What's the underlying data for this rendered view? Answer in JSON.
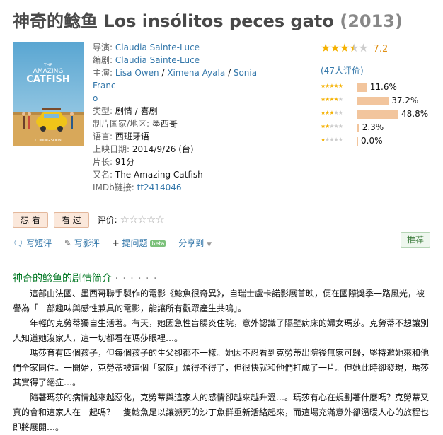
{
  "title": {
    "zh": "神奇的鲶鱼",
    "original": "Los insólitos peces gato",
    "year": "(2013)"
  },
  "poster": {
    "text1": "THE",
    "text2": "AMAZING",
    "text3": "CATFISH",
    "footer": "COMING SOON",
    "colors": {
      "sky": "#6fb5d8",
      "sand": "#d8a85a",
      "car": "#f0c419"
    }
  },
  "info": {
    "director_label": "导演:",
    "director": "Claudia Sainte-Luce",
    "writer_label": "编剧:",
    "writer": "Claudia Sainte-Luce",
    "cast_label": "主演:",
    "cast1": "Lisa Owen",
    "cast_sep1": " / ",
    "cast2": "Ximena Ayala",
    "cast_sep2": " / ",
    "cast3": "Sonia Franc",
    "cast3_cont": "o",
    "genre_label": "类型:",
    "genre1": "剧情",
    "genre_sep": " / ",
    "genre2": "喜剧",
    "country_label": "制片国家/地区:",
    "country": "墨西哥",
    "language_label": "语言:",
    "language": "西班牙语",
    "release_label": "上映日期:",
    "release": "2014/9/26 (台)",
    "runtime_label": "片长:",
    "runtime": "91分",
    "aka_label": "又名:",
    "aka": "The Amazing Catfish",
    "imdb_label": "IMDb链接:",
    "imdb": "tt2414046"
  },
  "rating": {
    "score": "7.2",
    "stars_on": "★★★",
    "stars_half": "★",
    "stars_off": "★",
    "votes": "(47人评价)",
    "distribution": [
      {
        "stars": 5,
        "percent": 11.6,
        "label": "11.6%"
      },
      {
        "stars": 4,
        "percent": 37.2,
        "label": "37.2%"
      },
      {
        "stars": 3,
        "percent": 48.8,
        "label": "48.8%"
      },
      {
        "stars": 2,
        "percent": 2.3,
        "label": "2.3%"
      },
      {
        "stars": 1,
        "percent": 0.0,
        "label": "0.0%"
      }
    ]
  },
  "actions": {
    "want": "想 看",
    "seen": "看 过",
    "rate_label": "评价:",
    "rate_stars": "☆☆☆☆☆"
  },
  "tools": {
    "short_review": "写短评",
    "review": "写影评",
    "ask": "提问题",
    "beta": "beta",
    "share": "分享到",
    "recommend": "推荐"
  },
  "synopsis": {
    "heading": "神奇的鲶鱼的剧情简介",
    "heading_dots": "· · · · · ·",
    "paragraphs": [
      "這部由法國、墨西哥聯手製作的電影《鯰魚很奇異》，自瑞士盧卡諾影展首映，便在國際獎季一路風光，被譽為「一部趣味與感性兼具的電影，能讓所有觀眾產生共鳴」。",
      "年輕的克勞蒂獨自生活著。有天，她因急性盲腸炎住院，意外認識了隔壁病床的婦女瑪莎。克勞蒂不想讓別人知道她沒家人，這一切都看在瑪莎眼裡…。",
      "瑪莎育有四個孩子，但每個孩子的生父卻都不一樣。她因不忍看到克勞蒂出院後無家可歸，堅持邀她來和他們全家同住。一開始，克勞蒂被這個「家庭」煩得不得了，但很快就和他們打成了一片。但她此時卻發現，瑪莎其實得了絕症…。",
      "隨著瑪莎的病情越來越惡化，克勞蒂與這家人的感情卻越來越升溫…。瑪莎有心在規劃著什麼嗎？克勞蒂又真的會和這家人在一起嗎？一隻鯰魚足以讓瀕死的沙丁魚群重新活絡起來，而這場充滿意外卻溫暖人心的旅程也即將展開…。"
    ]
  }
}
